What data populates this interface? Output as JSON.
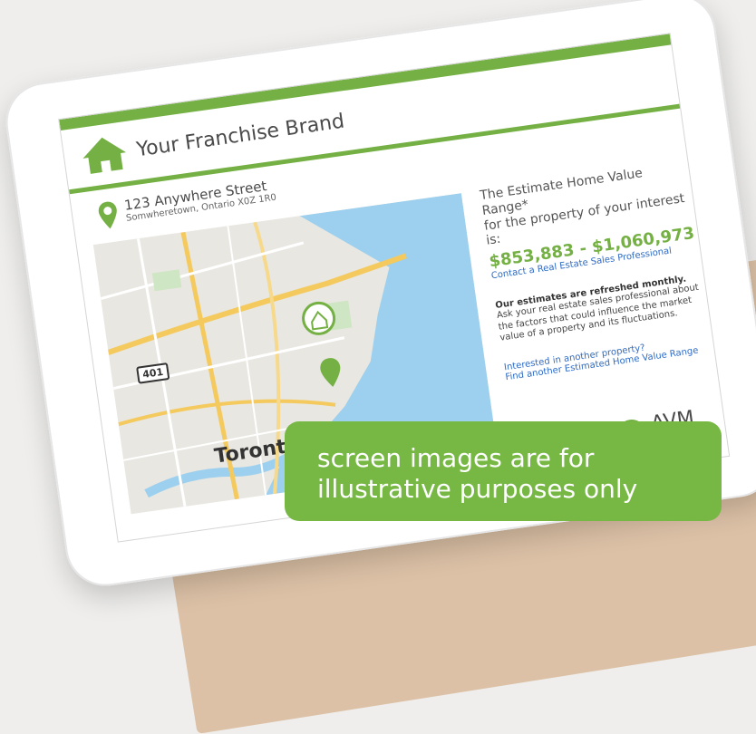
{
  "brand": {
    "name": "Your Franchise Brand",
    "color": "#74b043"
  },
  "address": {
    "street": "123 Anywhere Street",
    "city": "Somwheretown, Ontario  X0Z 1R0"
  },
  "map": {
    "city_label": "Toronto",
    "highway_label": "401"
  },
  "estimate": {
    "title_line1": "The Estimate Home Value Range*",
    "title_line2": "for the property of your interest is:",
    "range": "$853,883 - $1,060,973",
    "contact_link": "Contact a Real Estate Sales Professional",
    "refresh_title": "Our estimates are refreshed monthly.",
    "refresh_line1": "Ask your real estate sales professional about",
    "refresh_line2": "the factors that could influence the market",
    "refresh_line3": "value of a property and its fluctuations.",
    "another_line1": "Interested in another property?",
    "another_line2": "Find another Estimated Home Value Range"
  },
  "avm": {
    "label": "AVM"
  },
  "disclaimer": {
    "line1": "screen images are for",
    "line2": "illustrative purposes only"
  },
  "colors": {
    "accent_green": "#74b043",
    "link_blue": "#2e6bc6",
    "water_blue": "#9dd0ee"
  }
}
